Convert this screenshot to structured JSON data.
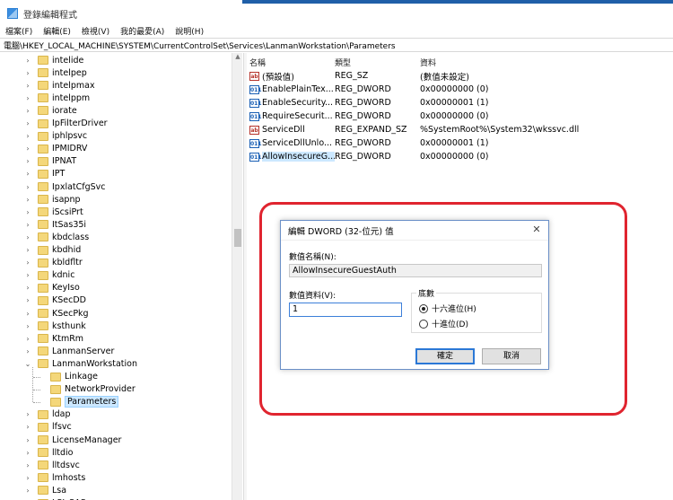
{
  "window": {
    "title": "登錄編輯程式"
  },
  "menu": [
    "檔案(F)",
    "編輯(E)",
    "檢視(V)",
    "我的最愛(A)",
    "說明(H)"
  ],
  "address": "電腦\\HKEY_LOCAL_MACHINE\\SYSTEM\\CurrentControlSet\\Services\\LanmanWorkstation\\Parameters",
  "tree": {
    "items": [
      "intelide",
      "intelpep",
      "intelpmax",
      "intelppm",
      "iorate",
      "IpFilterDriver",
      "iphlpsvc",
      "IPMIDRV",
      "IPNAT",
      "IPT",
      "IpxlatCfgSvc",
      "isapnp",
      "iScsiPrt",
      "ItSas35i",
      "kbdclass",
      "kbdhid",
      "kbldfltr",
      "kdnic",
      "KeyIso",
      "KSecDD",
      "KSecPkg",
      "ksthunk",
      "KtmRm",
      "LanmanServer",
      "LanmanWorkstation"
    ],
    "children": [
      "Linkage",
      "NetworkProvider",
      "Parameters"
    ],
    "after": [
      "ldap",
      "lfsvc",
      "LicenseManager",
      "lltdio",
      "lltdsvc",
      "lmhosts",
      "Lsa",
      "LSI_SAS"
    ]
  },
  "values": {
    "headers": {
      "name": "名稱",
      "type": "類型",
      "data": "資料"
    },
    "rows": [
      {
        "icon": "string-value-icon",
        "name": "(預設值)",
        "type": "REG_SZ",
        "data": "(數值未設定)"
      },
      {
        "icon": "binary-value-icon",
        "name": "EnablePlainTex...",
        "type": "REG_DWORD",
        "data": "0x00000000 (0)"
      },
      {
        "icon": "binary-value-icon",
        "name": "EnableSecurity...",
        "type": "REG_DWORD",
        "data": "0x00000001 (1)"
      },
      {
        "icon": "binary-value-icon",
        "name": "RequireSecurit...",
        "type": "REG_DWORD",
        "data": "0x00000000 (0)"
      },
      {
        "icon": "string-value-icon",
        "name": "ServiceDll",
        "type": "REG_EXPAND_SZ",
        "data": "%SystemRoot%\\System32\\wkssvc.dll"
      },
      {
        "icon": "binary-value-icon",
        "name": "ServiceDllUnlo...",
        "type": "REG_DWORD",
        "data": "0x00000001 (1)"
      },
      {
        "icon": "binary-value-icon",
        "name": "AllowInsecureG...",
        "type": "REG_DWORD",
        "data": "0x00000000 (0)"
      }
    ]
  },
  "dialog": {
    "title": "編輯 DWORD (32-位元) 值",
    "name_label": "數值名稱(N):",
    "name_value": "AllowInsecureGuestAuth",
    "data_label": "數值資料(V):",
    "data_value": "1",
    "base_label": "底數",
    "hex_label": "十六進位(H)",
    "dec_label": "十進位(D)",
    "ok_label": "確定",
    "cancel_label": "取消",
    "close_glyph": "✕"
  },
  "colors": {
    "highlight": "#e0242f",
    "selection": "#cce8ff",
    "accent": "#2b78d6"
  }
}
